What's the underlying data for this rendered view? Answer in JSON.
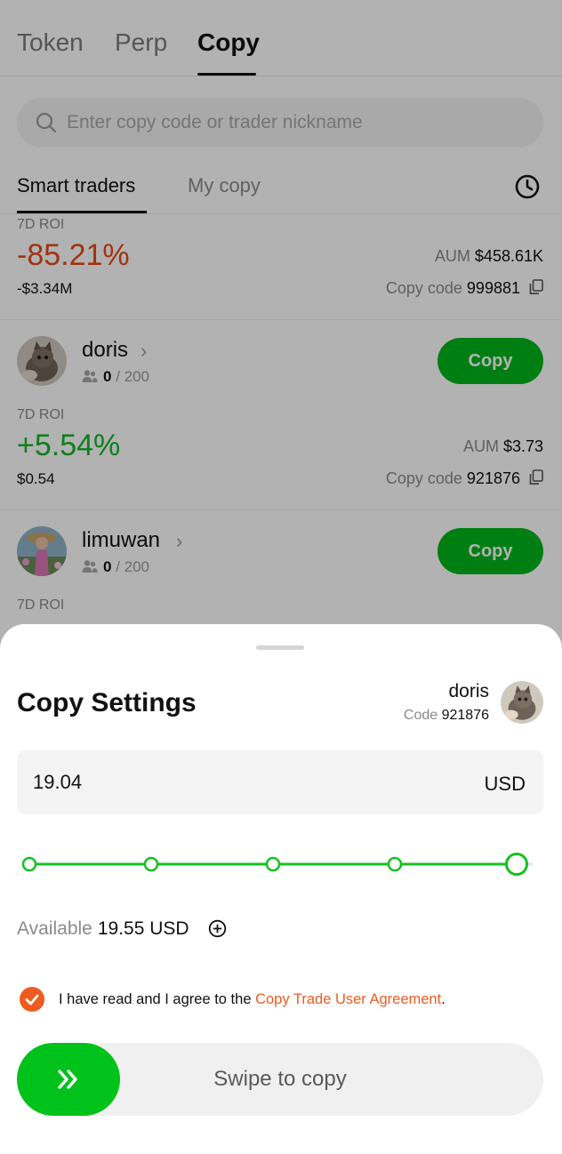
{
  "top_tabs": [
    {
      "label": "Token"
    },
    {
      "label": "Perp"
    },
    {
      "label": "Copy"
    }
  ],
  "search": {
    "placeholder": "Enter copy code or trader nickname"
  },
  "sub_tabs": [
    {
      "label": "Smart traders"
    },
    {
      "label": "My copy"
    }
  ],
  "traders": [
    {
      "roi_label": "7D ROI",
      "roi": "-85.21%",
      "pnl": "-$3.34M",
      "aum_label": "AUM",
      "aum": "$458.61K",
      "code_label": "Copy code",
      "code": "999881"
    },
    {
      "name": "doris",
      "copiers": "0",
      "max_copiers": "/ 200",
      "copy_label": "Copy",
      "roi_label": "7D ROI",
      "roi": "+5.54%",
      "pnl": "$0.54",
      "aum_label": "AUM",
      "aum": "$3.73",
      "code_label": "Copy code",
      "code": "921876"
    },
    {
      "name": "limuwan",
      "copiers": "0",
      "max_copiers": "/ 200",
      "copy_label": "Copy",
      "roi_label": "7D ROI"
    }
  ],
  "sheet": {
    "title": "Copy Settings",
    "trader_name": "doris",
    "code_label": "Code",
    "code": "921876",
    "amount": "19.04",
    "unit": "USD",
    "slider_steps": 5,
    "slider_value": 1.0,
    "available_label": "Available",
    "available_value": "19.55 USD",
    "agreement_prefix": "I have read and I agree to the ",
    "agreement_link": "Copy Trade User Agreement",
    "agreement_suffix": ".",
    "swipe_label": "Swipe to copy"
  },
  "colors": {
    "accent_green": "#00b51b",
    "negative": "#e64a19",
    "positive": "#14b829",
    "link": "#f05a1e"
  }
}
